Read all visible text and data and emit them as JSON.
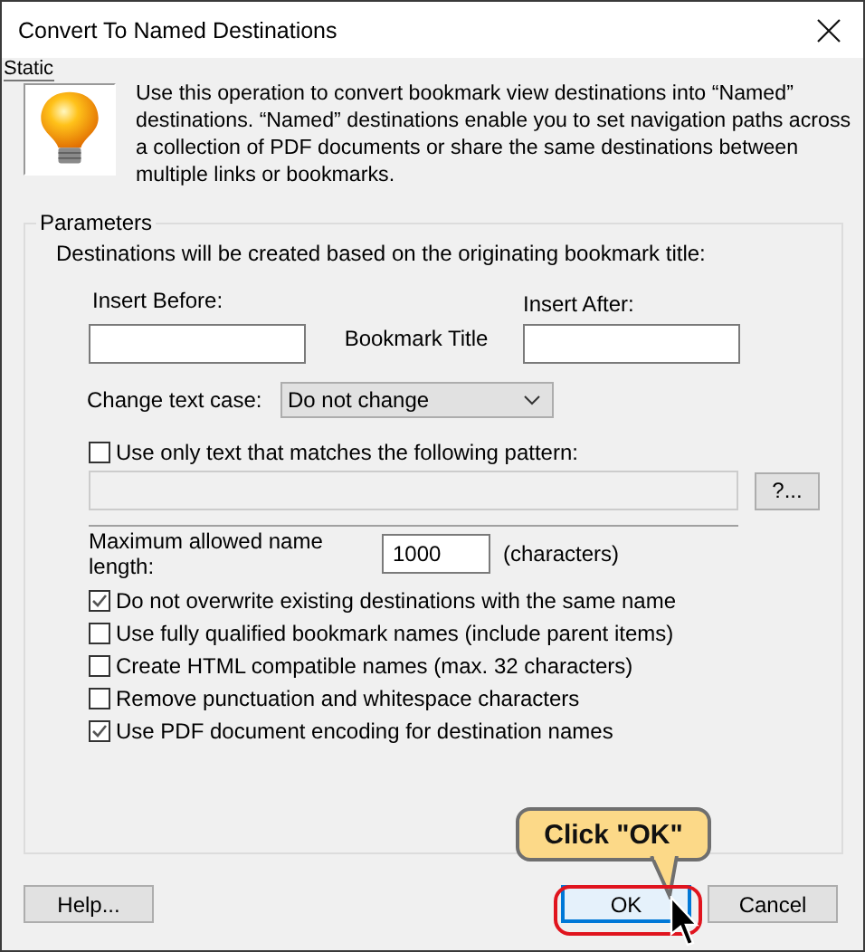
{
  "window": {
    "title": "Convert To Named Destinations"
  },
  "static_label": "Static",
  "description": "Use this operation to convert bookmark view destinations into “Named” destinations. “Named” destinations enable you to set navigation paths across a collection of PDF documents or share the same destinations between multiple links or bookmarks.",
  "parameters": {
    "title": "Parameters",
    "intro": "Destinations will be created based on the originating bookmark title:",
    "insert_before": {
      "label": "Insert Before:"
    },
    "bookmark_title": "Bookmark Title",
    "insert_after": {
      "label": "Insert After:"
    },
    "text_case": {
      "label": "Change text case:",
      "value": "Do not change"
    },
    "pattern": {
      "label": "Use only text that matches the following pattern:",
      "checked": false,
      "field_disabled": true,
      "button": "?..."
    },
    "max_length": {
      "label": "Maximum allowed name length:",
      "value": "1000",
      "unit": "(characters)"
    },
    "options": [
      {
        "label": "Do not overwrite existing destinations with the same name",
        "checked": true
      },
      {
        "label": "Use fully qualified bookmark names (include parent items)",
        "checked": false
      },
      {
        "label": "Create HTML compatible names (max. 32 characters)",
        "checked": false
      },
      {
        "label": "Remove punctuation and whitespace characters",
        "checked": false
      },
      {
        "label": "Use PDF document encoding for destination names",
        "checked": true
      }
    ]
  },
  "buttons": [
    {
      "label": "Help...",
      "kind": "plain"
    },
    {
      "label": "OK",
      "kind": "default"
    },
    {
      "label": "Cancel",
      "kind": "plain"
    }
  ],
  "callout": {
    "text": "Click \"OK\""
  }
}
